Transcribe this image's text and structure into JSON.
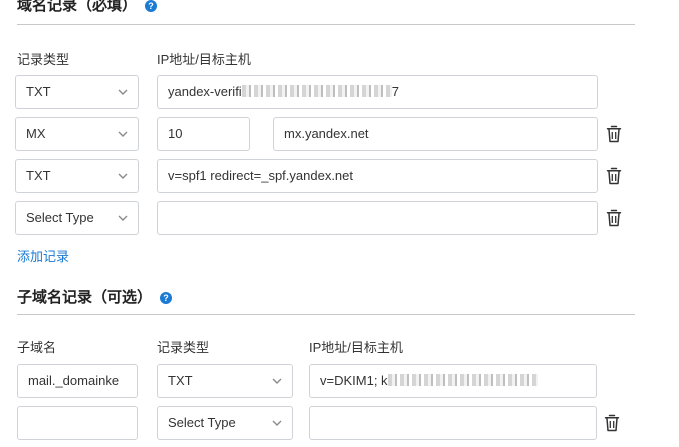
{
  "domain_section": {
    "title": "域名记录（必填）",
    "help_icon": "?",
    "col_type_label": "记录类型",
    "col_host_label": "IP地址/目标主机",
    "rows": [
      {
        "type": "TXT",
        "value_prefix": "yandex-verifi",
        "value_suffix": "7"
      },
      {
        "type": "MX",
        "priority": "10",
        "value": "mx.yandex.net"
      },
      {
        "type": "TXT",
        "value": "v=spf1 redirect=_spf.yandex.net"
      },
      {
        "type": "Select Type",
        "value": ""
      }
    ],
    "add_link": "添加记录"
  },
  "subdomain_section": {
    "title": "子域名记录（可选）",
    "help_icon": "?",
    "col_name_label": "子域名",
    "col_type_label": "记录类型",
    "col_host_label": "IP地址/目标主机",
    "rows": [
      {
        "name": "mail._domainke",
        "type": "TXT",
        "value_prefix": "v=DKIM1; k"
      },
      {
        "name": "",
        "type": "Select Type",
        "value": ""
      }
    ]
  },
  "colors": {
    "accent": "#1a7ad4",
    "border": "#cfd3d7",
    "text": "#333333"
  }
}
